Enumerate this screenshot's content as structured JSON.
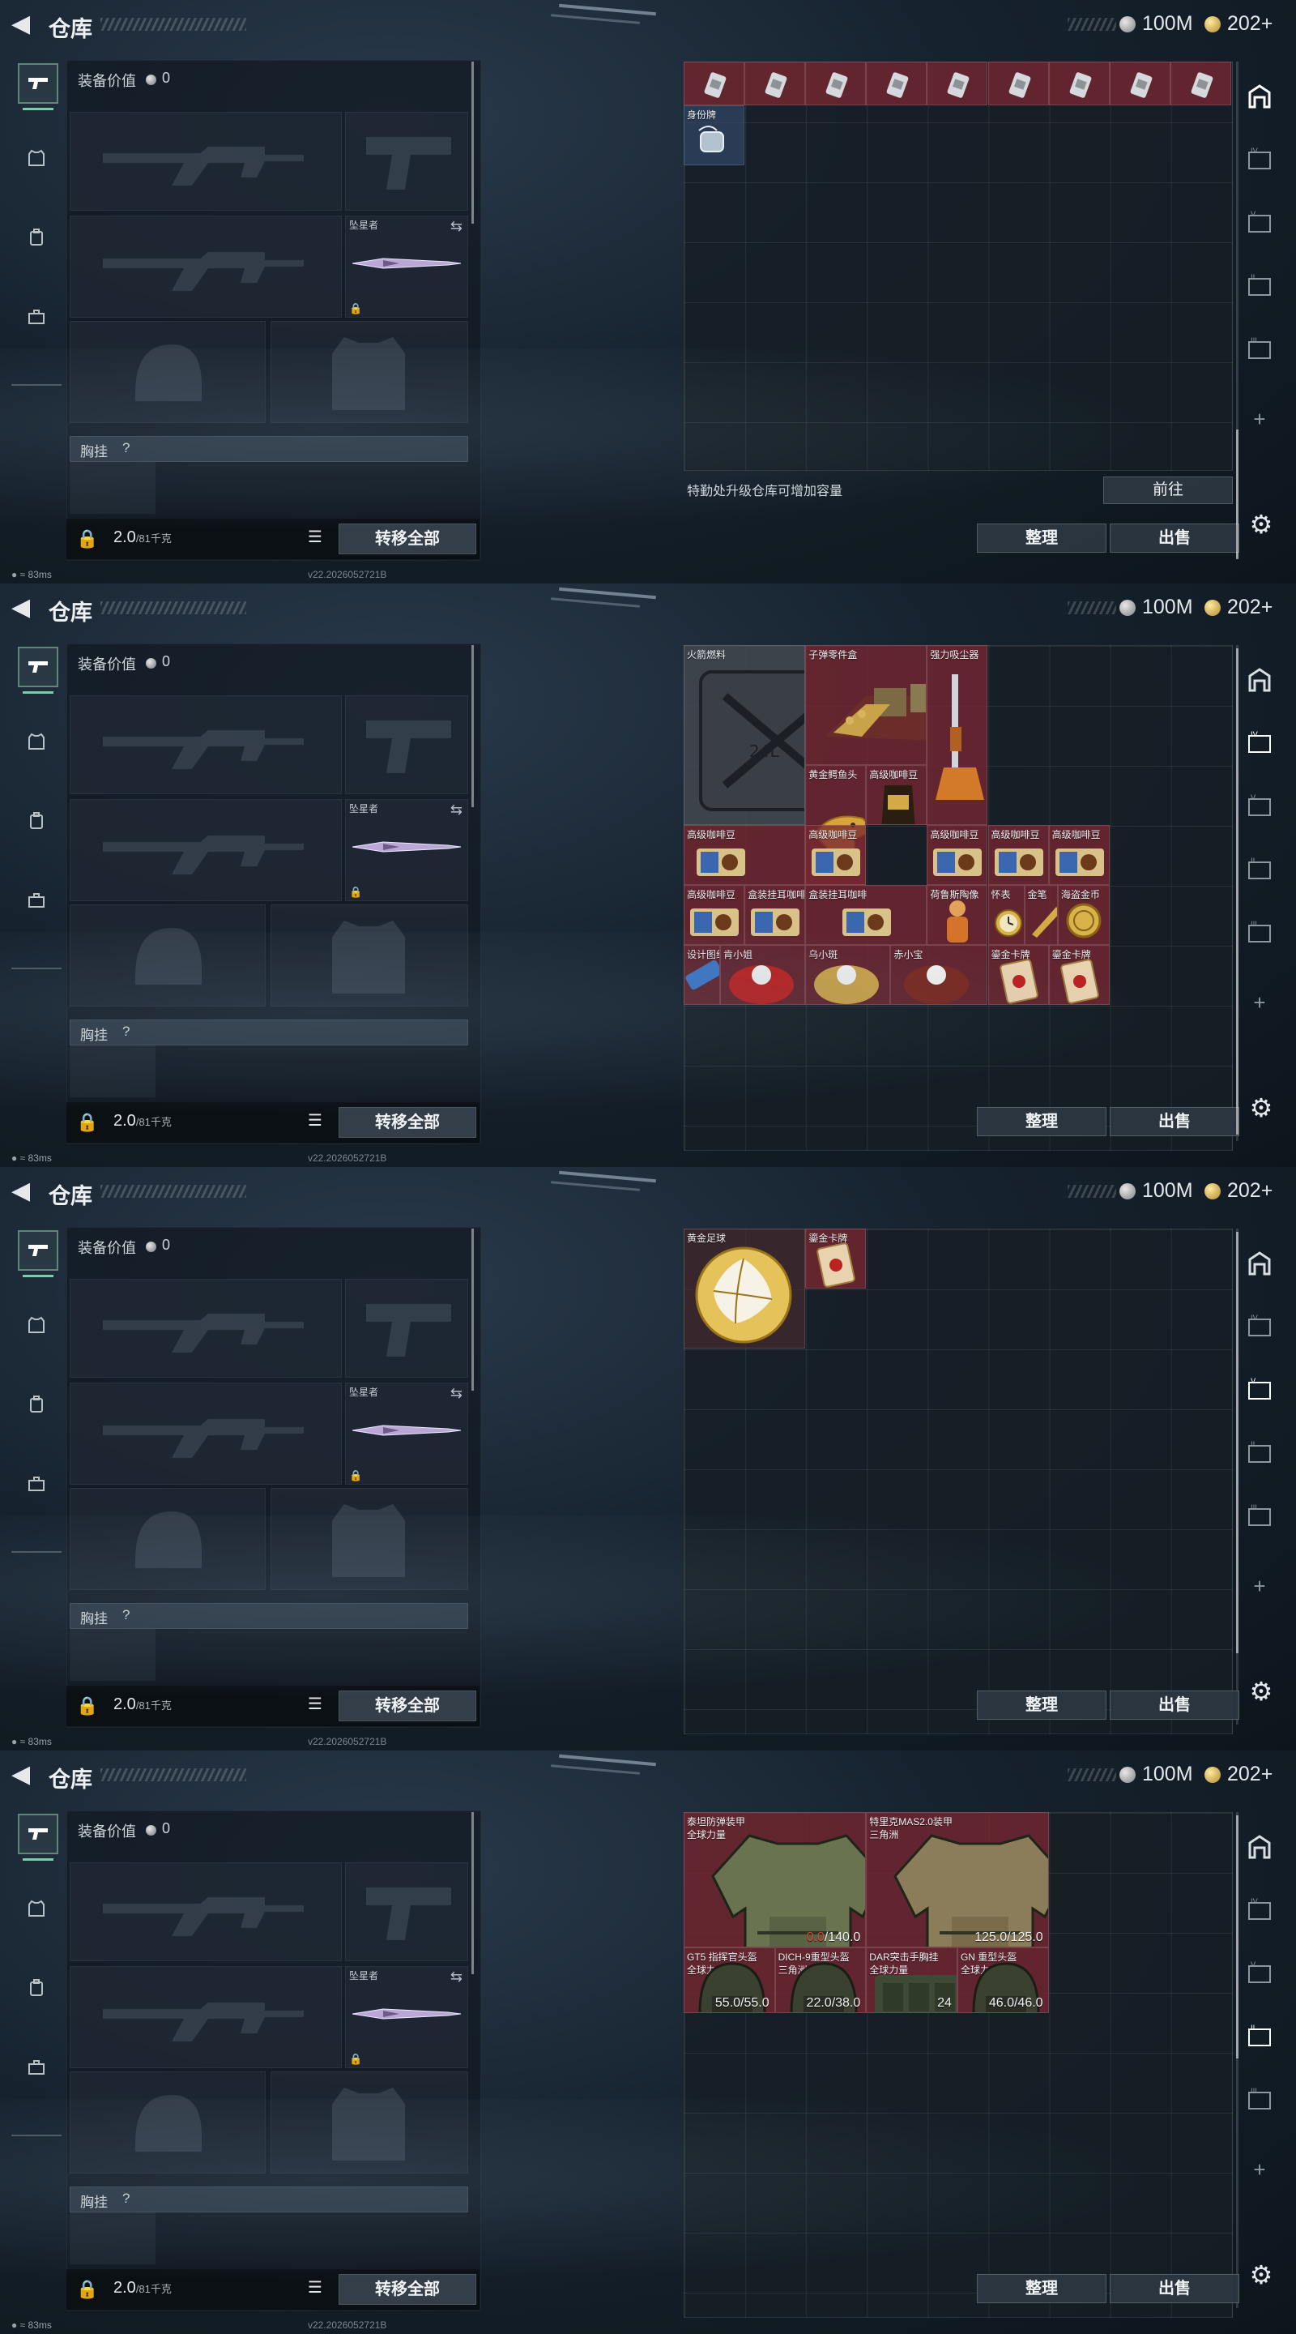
{
  "header": {
    "title": "仓库",
    "currency_silver": "100M",
    "currency_gold": "202+"
  },
  "equipment": {
    "value_label": "装备价值",
    "value": "0",
    "knife_name": "坠星者",
    "chest_label": "胸挂",
    "chest_help": "?",
    "weight_current": "2.0",
    "weight_max": "/81千克",
    "transfer_all": "转移全部"
  },
  "status": {
    "ping": "83ms",
    "build": "v22.2026052721B"
  },
  "storage": {
    "sort": "整理",
    "sell": "出售",
    "upgrade_hint": "特勤处升级仓库可增加容量",
    "goto": "前往"
  },
  "screen1": {
    "dogtag_name": "身份牌"
  },
  "screen2": {
    "items": [
      {
        "name": "火箭燃料"
      },
      {
        "name": "子弹零件盒"
      },
      {
        "name": "强力吸尘器"
      },
      {
        "name": "黄金鳄鱼头"
      },
      {
        "name": "高级咖啡豆"
      },
      {
        "name": "高级咖啡豆"
      },
      {
        "name": "高级咖啡豆"
      },
      {
        "name": "高级咖啡豆"
      },
      {
        "name": "高级咖啡豆"
      },
      {
        "name": "盒装挂耳咖啡"
      },
      {
        "name": "荷鲁斯陶像"
      },
      {
        "name": "怀表"
      },
      {
        "name": "金笔"
      },
      {
        "name": "海盗金币"
      },
      {
        "name": "设计图纸"
      },
      {
        "name": "肯小姐"
      },
      {
        "name": "乌小斑"
      },
      {
        "name": "赤小宝"
      },
      {
        "name": "鎏金卡牌"
      },
      {
        "name": "鎏金卡牌"
      }
    ]
  },
  "screen3": {
    "items": [
      {
        "name": "黄金足球"
      },
      {
        "name": "鎏金卡牌"
      }
    ]
  },
  "screen4": {
    "items": [
      {
        "name": "泰坦防弹装甲",
        "sub": "全球力量",
        "dura_current": "0.0",
        "dura_max": "/140.0"
      },
      {
        "name": "特里克MAS2.0装甲",
        "sub": "三角洲",
        "dura": "125.0/125.0"
      },
      {
        "name": "GT5 指挥官头盔",
        "sub": "全球力量",
        "dura": "55.0/55.0"
      },
      {
        "name": "DICH-9重型头盔",
        "sub": "三角洲",
        "dura": "22.0/38.0"
      },
      {
        "name": "DAR突击手胸挂",
        "sub": "全球力量",
        "dura": "24"
      },
      {
        "name": "GN 重型头盔",
        "sub": "全球力量",
        "dura": "46.0/46.0"
      }
    ]
  }
}
